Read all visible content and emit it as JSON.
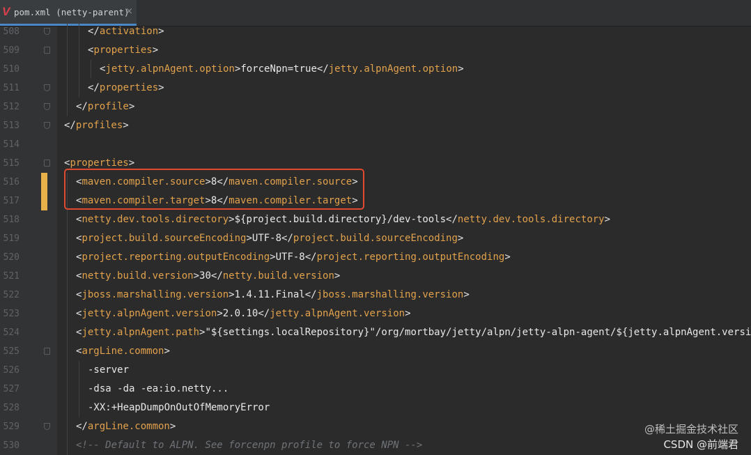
{
  "tab": {
    "icon": "maven-icon",
    "title": "pom.xml (netty-parent)",
    "close": "×"
  },
  "editor": {
    "lines": [
      {
        "num": "508",
        "indent": 2,
        "parts": [
          [
            "t",
            "</"
          ],
          [
            "n",
            "activation"
          ],
          [
            "t",
            ">"
          ]
        ]
      },
      {
        "num": "509",
        "indent": 2,
        "parts": [
          [
            "t",
            "<"
          ],
          [
            "n",
            "properties"
          ],
          [
            "t",
            ">"
          ]
        ]
      },
      {
        "num": "510",
        "indent": 3,
        "parts": [
          [
            "t",
            "<"
          ],
          [
            "n",
            "jetty.alpnAgent.option"
          ],
          [
            "t",
            ">"
          ],
          [
            "v",
            "forceNpn=true"
          ],
          [
            "t",
            "</"
          ],
          [
            "n",
            "jetty.alpnAgent.option"
          ],
          [
            "t",
            ">"
          ]
        ]
      },
      {
        "num": "511",
        "indent": 2,
        "parts": [
          [
            "t",
            "</"
          ],
          [
            "n",
            "properties"
          ],
          [
            "t",
            ">"
          ]
        ]
      },
      {
        "num": "512",
        "indent": 1,
        "parts": [
          [
            "t",
            "</"
          ],
          [
            "n",
            "profile"
          ],
          [
            "t",
            ">"
          ]
        ]
      },
      {
        "num": "513",
        "indent": 0,
        "parts": [
          [
            "t",
            "</"
          ],
          [
            "n",
            "profiles"
          ],
          [
            "t",
            ">"
          ]
        ]
      },
      {
        "num": "514",
        "indent": 0,
        "parts": []
      },
      {
        "num": "515",
        "indent": 0,
        "parts": [
          [
            "t",
            "<"
          ],
          [
            "n",
            "properties"
          ],
          [
            "t",
            ">"
          ]
        ]
      },
      {
        "num": "516",
        "indent": 1,
        "parts": [
          [
            "t",
            "<"
          ],
          [
            "n",
            "maven.compiler.source"
          ],
          [
            "t",
            ">"
          ],
          [
            "v",
            "8"
          ],
          [
            "t",
            "</"
          ],
          [
            "n",
            "maven.compiler.source"
          ],
          [
            "t",
            ">"
          ]
        ]
      },
      {
        "num": "517",
        "indent": 1,
        "parts": [
          [
            "t",
            "<"
          ],
          [
            "n",
            "maven.compiler.target"
          ],
          [
            "t",
            ">"
          ],
          [
            "v",
            "8"
          ],
          [
            "t",
            "</"
          ],
          [
            "n",
            "maven.compiler.target"
          ],
          [
            "t",
            ">"
          ]
        ]
      },
      {
        "num": "518",
        "indent": 1,
        "parts": [
          [
            "t",
            "<"
          ],
          [
            "n",
            "netty.dev.tools.directory"
          ],
          [
            "t",
            ">"
          ],
          [
            "v",
            "${project.build.directory}/dev-tools"
          ],
          [
            "t",
            "</"
          ],
          [
            "n",
            "netty.dev.tools.directory"
          ],
          [
            "t",
            ">"
          ]
        ]
      },
      {
        "num": "519",
        "indent": 1,
        "parts": [
          [
            "t",
            "<"
          ],
          [
            "n",
            "project.build.sourceEncoding"
          ],
          [
            "t",
            ">"
          ],
          [
            "v",
            "UTF-8"
          ],
          [
            "t",
            "</"
          ],
          [
            "n",
            "project.build.sourceEncoding"
          ],
          [
            "t",
            ">"
          ]
        ]
      },
      {
        "num": "520",
        "indent": 1,
        "parts": [
          [
            "t",
            "<"
          ],
          [
            "n",
            "project.reporting.outputEncoding"
          ],
          [
            "t",
            ">"
          ],
          [
            "v",
            "UTF-8"
          ],
          [
            "t",
            "</"
          ],
          [
            "n",
            "project.reporting.outputEncoding"
          ],
          [
            "t",
            ">"
          ]
        ]
      },
      {
        "num": "521",
        "indent": 1,
        "parts": [
          [
            "t",
            "<"
          ],
          [
            "n",
            "netty.build.version"
          ],
          [
            "t",
            ">"
          ],
          [
            "v",
            "30"
          ],
          [
            "t",
            "</"
          ],
          [
            "n",
            "netty.build.version"
          ],
          [
            "t",
            ">"
          ]
        ]
      },
      {
        "num": "522",
        "indent": 1,
        "parts": [
          [
            "t",
            "<"
          ],
          [
            "n",
            "jboss.marshalling.version"
          ],
          [
            "t",
            ">"
          ],
          [
            "v",
            "1.4.11.Final"
          ],
          [
            "t",
            "</"
          ],
          [
            "n",
            "jboss.marshalling.version"
          ],
          [
            "t",
            ">"
          ]
        ]
      },
      {
        "num": "523",
        "indent": 1,
        "parts": [
          [
            "t",
            "<"
          ],
          [
            "n",
            "jetty.alpnAgent.version"
          ],
          [
            "t",
            ">"
          ],
          [
            "v",
            "2.0.10"
          ],
          [
            "t",
            "</"
          ],
          [
            "n",
            "jetty.alpnAgent.version"
          ],
          [
            "t",
            ">"
          ]
        ]
      },
      {
        "num": "524",
        "indent": 1,
        "parts": [
          [
            "t",
            "<"
          ],
          [
            "n",
            "jetty.alpnAgent.path"
          ],
          [
            "t",
            ">"
          ],
          [
            "v",
            "\"${settings.localRepository}\"/org/mortbay/jetty/alpn/jetty-alpn-agent/${jetty.alpnAgent.version}"
          ]
        ]
      },
      {
        "num": "525",
        "indent": 1,
        "parts": [
          [
            "t",
            "<"
          ],
          [
            "n",
            "argLine.common"
          ],
          [
            "t",
            ">"
          ]
        ]
      },
      {
        "num": "526",
        "indent": 2,
        "parts": [
          [
            "v",
            "-server"
          ]
        ]
      },
      {
        "num": "527",
        "indent": 2,
        "parts": [
          [
            "v",
            "-dsa -da -ea:io.netty..."
          ]
        ]
      },
      {
        "num": "528",
        "indent": 2,
        "parts": [
          [
            "v",
            "-XX:+HeapDumpOnOutOfMemoryError"
          ]
        ]
      },
      {
        "num": "529",
        "indent": 1,
        "parts": [
          [
            "t",
            "</"
          ],
          [
            "n",
            "argLine.common"
          ],
          [
            "t",
            ">"
          ]
        ]
      },
      {
        "num": "530",
        "indent": 1,
        "parts": [
          [
            "c",
            "<!-- Default to ALPN. See forcenpn profile to force NPN -->"
          ]
        ]
      }
    ],
    "fold_markers": {
      "508": "end",
      "509": "start",
      "511": "end",
      "512": "end",
      "513": "end",
      "515": "start",
      "525": "start",
      "529": "end"
    },
    "changed_lines": [
      "516",
      "517"
    ]
  },
  "watermark": {
    "line1": "@稀土掘金技术社区",
    "line2": "CSDN @前端君"
  }
}
